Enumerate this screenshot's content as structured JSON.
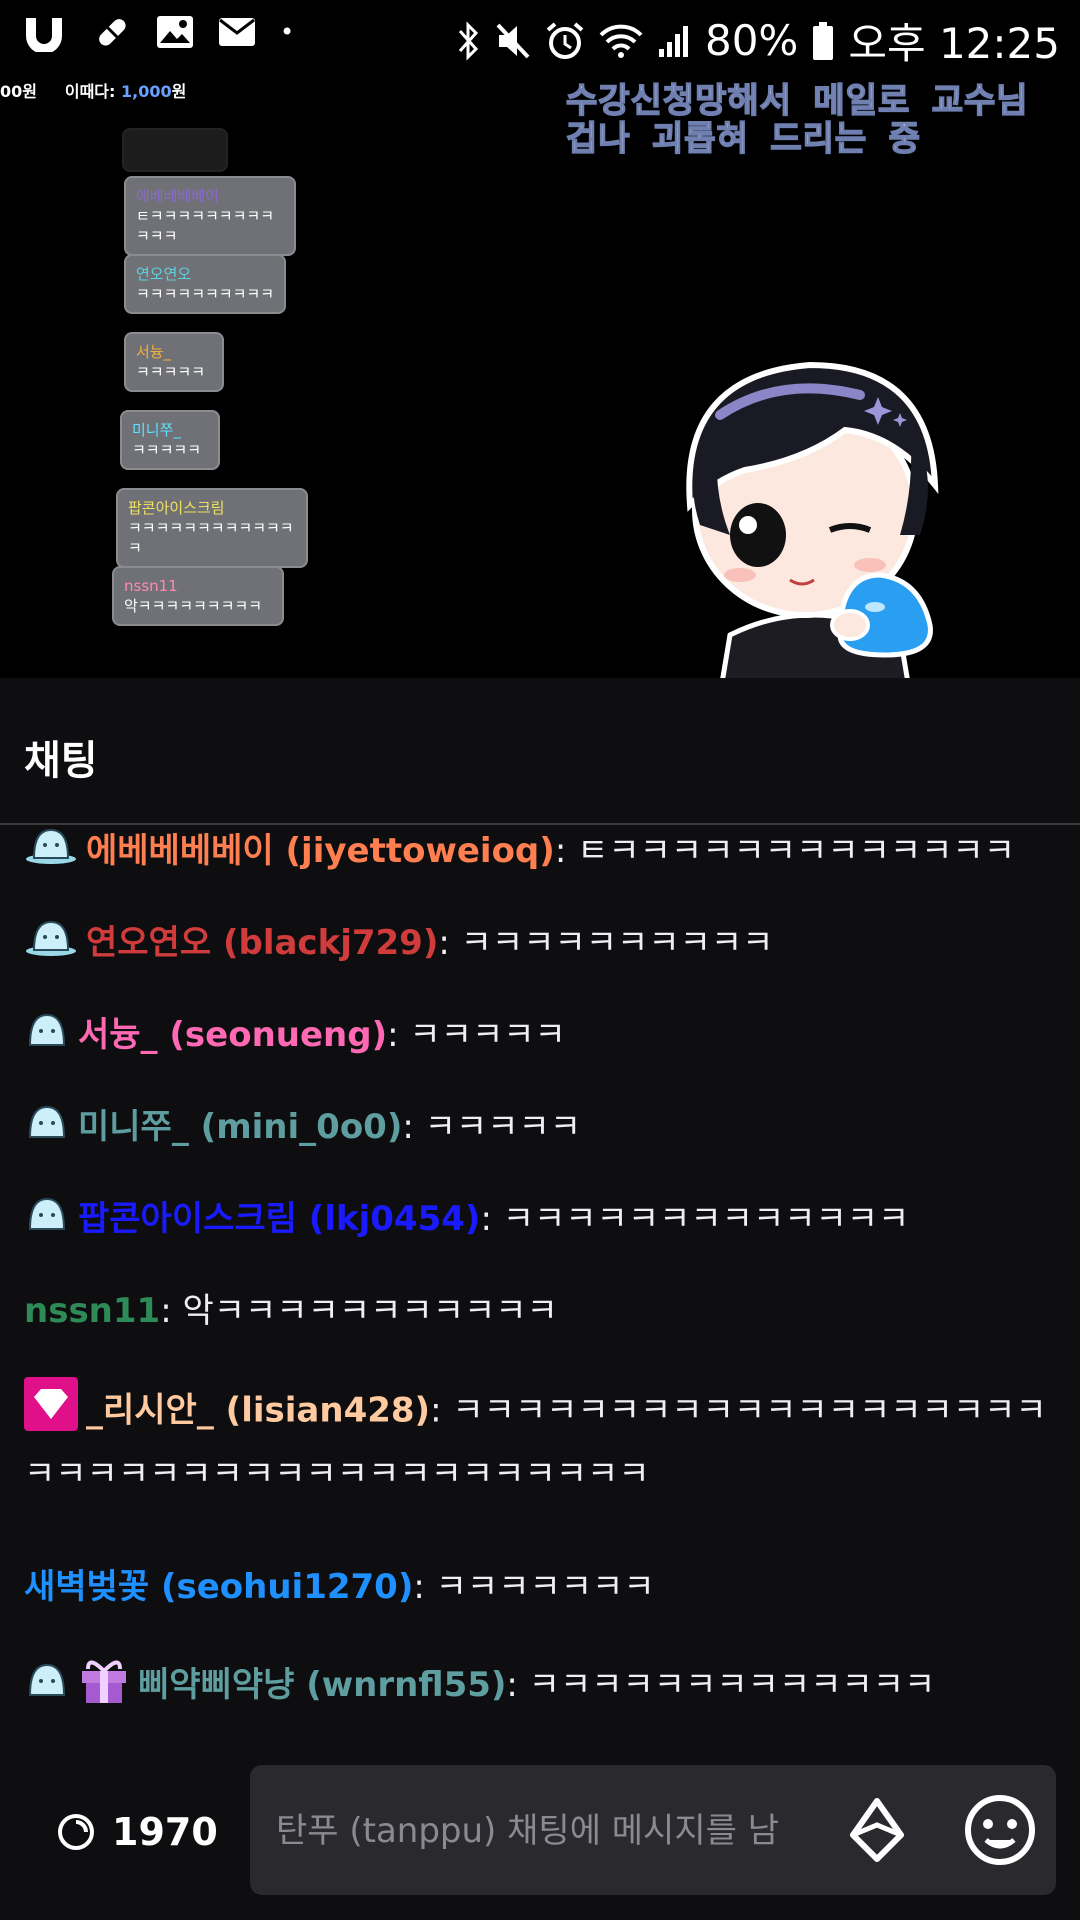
{
  "status_bar": {
    "battery": "80%",
    "time": "오후 12:25",
    "dot": "•"
  },
  "stream": {
    "donation": {
      "prefix": "00원",
      "label": "이때다:",
      "amount": "1,000",
      "suffix": "원"
    },
    "overlay_title_line1": "수강신청망해서 메일로 교수님",
    "overlay_title_line2": "겁나 괴롭혀 드리는 중",
    "bubbles": [
      {
        "name": "에베베베베이",
        "text": "ㅌㅋㅋㅋㅋㅋㅋㅋㅋㅋㅋㅋㅋ",
        "name_color": "#8a6ad0"
      },
      {
        "name": "연오연오",
        "text": "ㅋㅋㅋㅋㅋㅋㅋㅋㅋㅋ",
        "name_color": "#5fd0e0"
      },
      {
        "name": "서늉_",
        "text": "ㅋㅋㅋㅋㅋ",
        "name_color": "#f0b040"
      },
      {
        "name": "미니쭈_",
        "text": "ㅋㅋㅋㅋㅋ",
        "name_color": "#5fe0ff"
      },
      {
        "name": "팝콘아이스크림",
        "text": "ㅋㅋㅋㅋㅋㅋㅋㅋㅋㅋㅋㅋㅋ",
        "name_color": "#f0e060"
      },
      {
        "name": "nssn11",
        "text": "악ㅋㅋㅋㅋㅋㅋㅋㅋㅋ",
        "name_color": "#ff8ab0"
      }
    ]
  },
  "chat": {
    "header": "채팅",
    "messages": [
      {
        "user": "에베베베베이 (jiyettoweioq)",
        "color": "#ff7f50",
        "text": ": ㅌㅋㅋㅋㅋㅋㅋㅋㅋㅋㅋㅋㅋㅋ",
        "badge": "sub-badge-icon"
      },
      {
        "user": "연오연오 (blackj729)",
        "color": "#d03c3c",
        "text": ": ㅋㅋㅋㅋㅋㅋㅋㅋㅋㅋ",
        "badge": "sub-badge-icon"
      },
      {
        "user": "서늉_ (seonueng)",
        "color": "#ff69b4",
        "text": ": ㅋㅋㅋㅋㅋ",
        "badge": "sub-badge-icon"
      },
      {
        "user": "미니쭈_ (mini_0o0)",
        "color": "#5f9ea0",
        "text": ": ㅋㅋㅋㅋㅋ",
        "badge": "sub-badge-icon"
      },
      {
        "user": "팝콘아이스크림 (lkj0454)",
        "color": "#1a1aff",
        "text": ": ㅋㅋㅋㅋㅋㅋㅋㅋㅋㅋㅋㅋㅋ",
        "badge": "sub-badge-icon"
      },
      {
        "user": "nssn11",
        "color": "#2e8b57",
        "text": ": 악ㅋㅋㅋㅋㅋㅋㅋㅋㅋㅋㅋ",
        "badge": ""
      },
      {
        "user": "_리시안_ (lisian428)",
        "color": "#ffcaa0",
        "text": ": ㅋㅋㅋㅋㅋㅋㅋㅋㅋㅋㅋㅋㅋㅋㅋㅋㅋㅋㅋㅋㅋㅋㅋㅋㅋㅋㅋㅋㅋㅋㅋㅋㅋㅋㅋㅋㅋㅋㅋ",
        "badge": "gem-badge-icon"
      },
      {
        "user": "새벽벚꽃 (seohui1270)",
        "color": "#1e90ff",
        "text": ": ㅋㅋㅋㅋㅋㅋㅋ",
        "badge": ""
      },
      {
        "user": "삐약삐약냥 (wnrnfl55)",
        "color": "#5f9ea0",
        "text": ": ㅋㅋㅋㅋㅋㅋㅋㅋㅋㅋㅋㅋㅋ",
        "badge": "sub-badge-icon+gift-badge-icon"
      }
    ]
  },
  "bottom_bar": {
    "points": "1970",
    "input_placeholder": "탄푸 (tanppu) 채팅에 메시지를 남"
  }
}
